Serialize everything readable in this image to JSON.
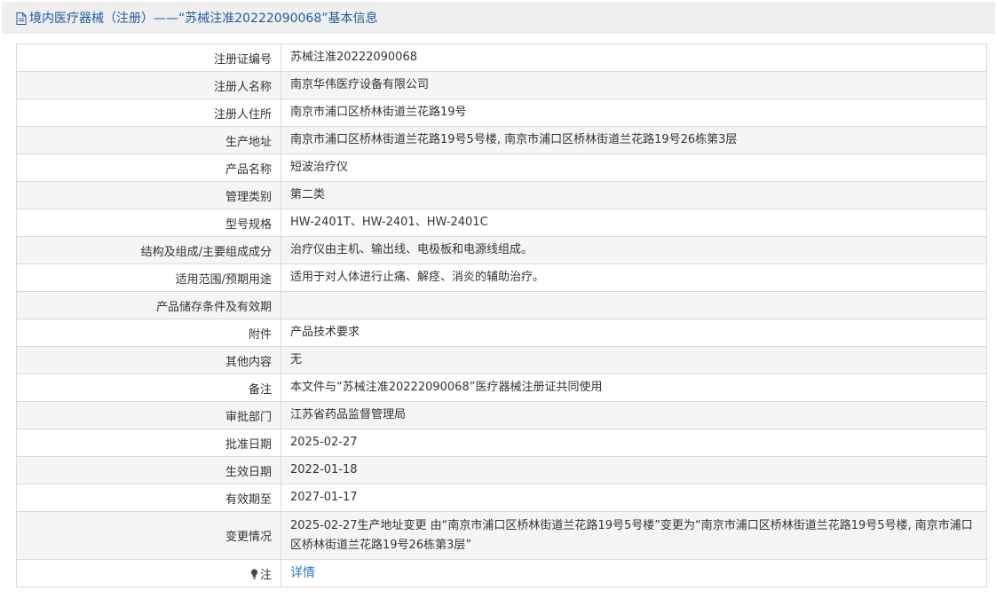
{
  "header": {
    "title": "境内医疗器械（注册）——“苏械注准20222090068”基本信息"
  },
  "rows": [
    {
      "label": "注册证编号",
      "value": "苏械注准20222090068"
    },
    {
      "label": "注册人名称",
      "value": "南京华伟医疗设备有限公司"
    },
    {
      "label": "注册人住所",
      "value": "南京市浦口区桥林街道兰花路19号"
    },
    {
      "label": "生产地址",
      "value": "南京市浦口区桥林街道兰花路19号5号楼, 南京市浦口区桥林街道兰花路19号26栋第3层"
    },
    {
      "label": "产品名称",
      "value": "短波治疗仪"
    },
    {
      "label": "管理类别",
      "value": "第二类"
    },
    {
      "label": "型号规格",
      "value": "HW-2401T、HW-2401、HW-2401C"
    },
    {
      "label": "结构及组成/主要组成成分",
      "value": "治疗仪由主机、输出线、电极板和电源线组成。"
    },
    {
      "label": "适用范围/预期用途",
      "value": "适用于对人体进行止痛、解痉、消炎的辅助治疗。"
    },
    {
      "label": "产品储存条件及有效期",
      "value": ""
    },
    {
      "label": "附件",
      "value": "产品技术要求"
    },
    {
      "label": "其他内容",
      "value": "无"
    },
    {
      "label": "备注",
      "value": "本文件与“苏械注准20222090068”医疗器械注册证共同使用"
    },
    {
      "label": "审批部门",
      "value": "江苏省药品监督管理局"
    },
    {
      "label": "批准日期",
      "value": "2025-02-27"
    },
    {
      "label": "生效日期",
      "value": "2022-01-18"
    },
    {
      "label": "有效期至",
      "value": "2027-01-17"
    },
    {
      "label": "变更情况",
      "value": "2025-02-27生产地址变更 由“南京市浦口区桥林街道兰花路19号5号楼”变更为“南京市浦口区桥林街道兰花路19号5号楼, 南京市浦口区桥林街道兰花路19号26栋第3层”"
    }
  ],
  "note": {
    "label": "注",
    "link_text": "详情"
  },
  "colors": {
    "header_bg": "#efefef",
    "title_blue": "#1f5aa0",
    "link_blue": "#2b7ac6",
    "border": "#d9d9d9",
    "row_alt": "#f5f5f5"
  }
}
